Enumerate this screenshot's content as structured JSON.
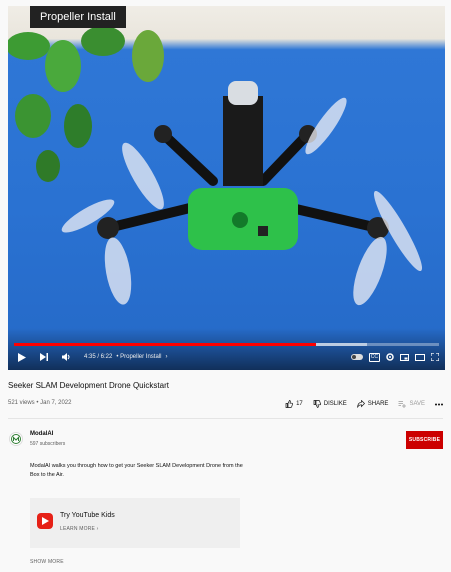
{
  "player": {
    "chapter_overlay": "Propeller Install",
    "time": "4:35 / 6:22",
    "chapter_label": "• Propeller Install",
    "progress_fraction": 0.71,
    "buffer_fraction": 0.83,
    "progress_color": "#ff0000"
  },
  "video": {
    "title": "Seeker SLAM Development Drone Quickstart",
    "views_date": "521 views • Jan 7, 2022"
  },
  "actions": {
    "like_count": "17",
    "dislike_label": "DISLIKE",
    "share_label": "SHARE",
    "save_label": "SAVE"
  },
  "channel": {
    "name": "ModalAI",
    "subscribers": "597 subscribers",
    "subscribe_label": "SUBSCRIBE",
    "subscribe_color": "#cc0000"
  },
  "description": "ModalAI walks you through how to get your Seeker SLAM Development Drone from the Box to the Air.",
  "kids_promo": {
    "title": "Try YouTube Kids",
    "learn_more": "LEARN MORE"
  },
  "show_more": "SHOW MORE",
  "icons": [
    "play-icon",
    "next-icon",
    "volume-icon",
    "cc-icon",
    "settings-icon",
    "miniplayer-icon",
    "theater-icon",
    "fullscreen-icon",
    "like-icon",
    "dislike-icon",
    "share-icon",
    "save-icon",
    "more-icon",
    "youtube-kids-icon"
  ]
}
